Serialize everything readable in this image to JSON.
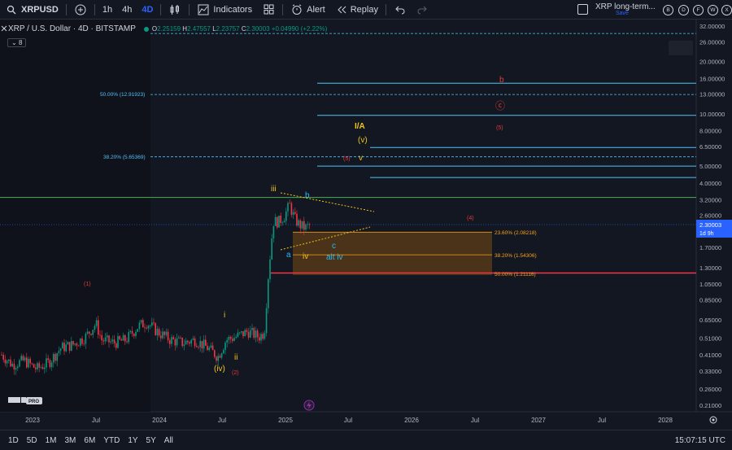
{
  "toolbar": {
    "symbol": "XRPUSD",
    "timeframes": [
      "1h",
      "4h",
      "4D"
    ],
    "active_timeframe": "4D",
    "indicators_label": "Indicators",
    "alert_label": "Alert",
    "replay_label": "Replay",
    "layout_title": "XRP long-term...",
    "layout_save": "Save",
    "account_buttons": [
      "B",
      "D",
      "F",
      "W",
      "X"
    ]
  },
  "legend": {
    "title": "XRP / U.S. Dollar · 4D · BITSTAMP",
    "open": "2.25159",
    "high": "2.47557",
    "low": "2.23757",
    "close": "2.30003",
    "change": "+0.04990 (+2.22%)",
    "indicator_count": "8"
  },
  "chart_data": {
    "type": "candlestick",
    "symbol": "XRPUSD",
    "exchange": "BITSTAMP",
    "interval": "4D",
    "scale": "log",
    "y_ticks": [
      32.0,
      26.0,
      20.0,
      16.0,
      13.0,
      10.0,
      8.0,
      6.5,
      5.0,
      4.0,
      3.2,
      2.6,
      2.1,
      1.7,
      1.3,
      1.05,
      0.85,
      0.65,
      0.51,
      0.41,
      0.33,
      0.26,
      0.21
    ],
    "y_tick_labels": [
      "32.00000",
      "26.00000",
      "20.00000",
      "16.00000",
      "13.00000",
      "10.00000",
      "8.00000",
      "6.50000",
      "5.00000",
      "4.00000",
      "3.20000",
      "2.60000",
      "2.10000",
      "1.70000",
      "1.30000",
      "1.05000",
      "0.85000",
      "0.65000",
      "0.51000",
      "0.41000",
      "0.33000",
      "0.26000",
      "0.21000"
    ],
    "x_tick_labels": [
      "2023",
      "Jul",
      "2024",
      "Jul",
      "2025",
      "Jul",
      "2026",
      "Jul",
      "2027",
      "Jul",
      "2028"
    ],
    "last_price": "2.30003",
    "countdown": "1d 9h",
    "fib_levels": [
      {
        "label": "50.00% (12.91923)",
        "value": 12.91923,
        "color": "#4fc3f7"
      },
      {
        "label": "38.20% (5.65369)",
        "value": 5.65369,
        "color": "#4fc3f7"
      },
      {
        "label": "23.60% (2.08218)",
        "value": 2.08218,
        "color": "#f7a21b"
      },
      {
        "label": "38.20% (1.54306)",
        "value": 1.54306,
        "color": "#f7a21b"
      },
      {
        "label": "50.00% (1.21116)",
        "value": 1.21116,
        "color": "#f7a21b"
      }
    ],
    "horizontal_lines": [
      {
        "value": 3.3,
        "color": "#4caf50"
      },
      {
        "value": 15.0,
        "color": "#4fc3f7"
      },
      {
        "value": 9.8,
        "color": "#4fc3f7"
      },
      {
        "value": 6.4,
        "color": "#4fc3f7"
      },
      {
        "value": 5.0,
        "color": "#4fc3f7"
      },
      {
        "value": 4.3,
        "color": "#4fc3f7"
      }
    ],
    "wave_labels": [
      {
        "text": "(1)",
        "color": "#e53935"
      },
      {
        "text": "i",
        "color": "#f0c419"
      },
      {
        "text": "ii",
        "color": "#f0c419"
      },
      {
        "text": "(iv)",
        "color": "#f0c419"
      },
      {
        "text": "(2)",
        "color": "#e53935"
      },
      {
        "text": "iii",
        "color": "#f0c419"
      },
      {
        "text": "a",
        "color": "#29b6f6"
      },
      {
        "text": "b",
        "color": "#29b6f6"
      },
      {
        "text": "c",
        "color": "#29b6f6"
      },
      {
        "text": "iv",
        "color": "#f0c419"
      },
      {
        "text": "alt iv",
        "color": "#29b6f6"
      },
      {
        "text": "(4)",
        "color": "#e53935"
      },
      {
        "text": "(5)",
        "color": "#e53935"
      },
      {
        "text": "v",
        "color": "#f0c419"
      },
      {
        "text": "(v)",
        "color": "#f0c419"
      },
      {
        "text": "I/A",
        "color": "#f0c419"
      },
      {
        "text": "(5)",
        "color": "#e53935"
      },
      {
        "text": "ⓒ",
        "color": "#e53935"
      },
      {
        "text": "b",
        "color": "#e53935"
      }
    ]
  },
  "bottombar": {
    "ranges": [
      "1D",
      "5D",
      "1M",
      "3M",
      "6M",
      "YTD",
      "1Y",
      "5Y",
      "All"
    ],
    "clock": "15:07:15 UTC"
  },
  "colors": {
    "background": "#131722",
    "up": "#089981",
    "down": "#f23645",
    "accent": "#2962ff"
  },
  "icons": [
    "plus-icon",
    "candles-icon",
    "indicators-icon",
    "templates-icon",
    "alert-icon",
    "replay-icon",
    "undo-icon",
    "redo-icon",
    "lightning-icon",
    "settings-icon",
    "tv-logo"
  ]
}
